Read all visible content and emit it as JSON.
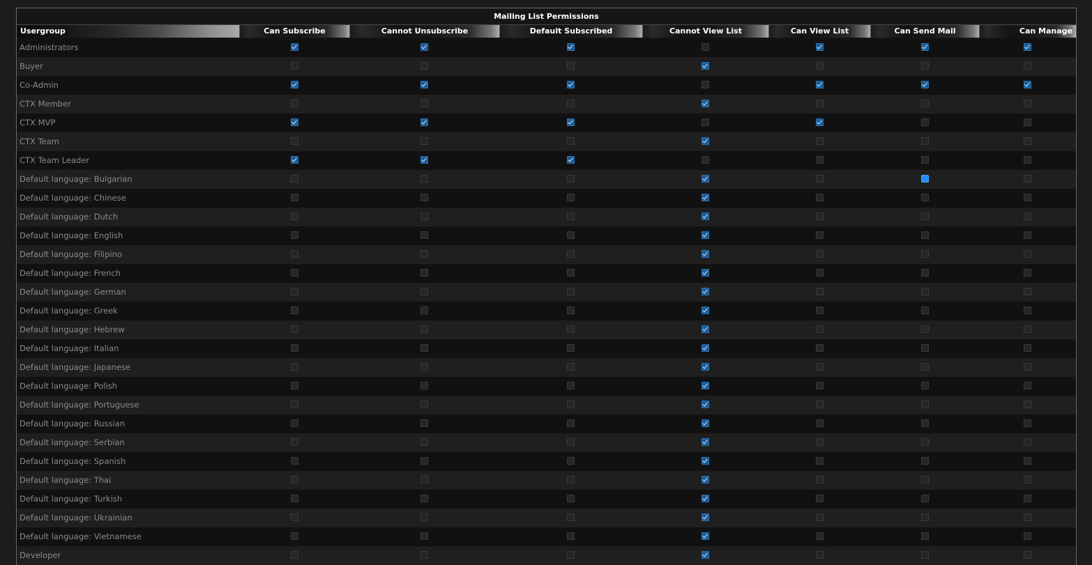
{
  "table": {
    "title": "Mailing List Permissions",
    "columns": [
      "Usergroup",
      "Can Subscribe",
      "Cannot Unsubscribe",
      "Default Subscribed",
      "Cannot View List",
      "Can View List",
      "Can Send Mail",
      "Can Manage"
    ],
    "rows": [
      {
        "label": "Administrators",
        "values": [
          true,
          true,
          true,
          false,
          true,
          true,
          true
        ]
      },
      {
        "label": "Buyer",
        "values": [
          false,
          false,
          false,
          true,
          false,
          false,
          false
        ]
      },
      {
        "label": "Co-Admin",
        "values": [
          true,
          true,
          true,
          false,
          true,
          true,
          true
        ]
      },
      {
        "label": "CTX Member",
        "values": [
          false,
          false,
          false,
          true,
          false,
          false,
          false
        ]
      },
      {
        "label": "CTX MVP",
        "values": [
          true,
          true,
          true,
          false,
          true,
          false,
          false
        ]
      },
      {
        "label": "CTX Team",
        "values": [
          false,
          false,
          false,
          true,
          false,
          false,
          false
        ]
      },
      {
        "label": "CTX Team Leader",
        "values": [
          true,
          true,
          true,
          false,
          false,
          false,
          false
        ]
      },
      {
        "label": "Default language: Bulgarian",
        "values": [
          false,
          false,
          false,
          true,
          false,
          "focus",
          false
        ]
      },
      {
        "label": "Default language: Chinese",
        "values": [
          false,
          false,
          false,
          true,
          false,
          false,
          false
        ]
      },
      {
        "label": "Default language: Dutch",
        "values": [
          false,
          false,
          false,
          true,
          false,
          false,
          false
        ]
      },
      {
        "label": "Default language: English",
        "values": [
          false,
          false,
          false,
          true,
          false,
          false,
          false
        ]
      },
      {
        "label": "Default language: Filipino",
        "values": [
          false,
          false,
          false,
          true,
          false,
          false,
          false
        ]
      },
      {
        "label": "Default language: French",
        "values": [
          false,
          false,
          false,
          true,
          false,
          false,
          false
        ]
      },
      {
        "label": "Default language: German",
        "values": [
          false,
          false,
          false,
          true,
          false,
          false,
          false
        ]
      },
      {
        "label": "Default language: Greek",
        "values": [
          false,
          false,
          false,
          true,
          false,
          false,
          false
        ]
      },
      {
        "label": "Default language: Hebrew",
        "values": [
          false,
          false,
          false,
          true,
          false,
          false,
          false
        ]
      },
      {
        "label": "Default language: Italian",
        "values": [
          false,
          false,
          false,
          true,
          false,
          false,
          false
        ]
      },
      {
        "label": "Default language: Japanese",
        "values": [
          false,
          false,
          false,
          true,
          false,
          false,
          false
        ]
      },
      {
        "label": "Default language: Polish",
        "values": [
          false,
          false,
          false,
          true,
          false,
          false,
          false
        ]
      },
      {
        "label": "Default language: Portuguese",
        "values": [
          false,
          false,
          false,
          true,
          false,
          false,
          false
        ]
      },
      {
        "label": "Default language: Russian",
        "values": [
          false,
          false,
          false,
          true,
          false,
          false,
          false
        ]
      },
      {
        "label": "Default language: Serbian",
        "values": [
          false,
          false,
          false,
          true,
          false,
          false,
          false
        ]
      },
      {
        "label": "Default language: Spanish",
        "values": [
          false,
          false,
          false,
          true,
          false,
          false,
          false
        ]
      },
      {
        "label": "Default language: Thai",
        "values": [
          false,
          false,
          false,
          true,
          false,
          false,
          false
        ]
      },
      {
        "label": "Default language: Turkish",
        "values": [
          false,
          false,
          false,
          true,
          false,
          false,
          false
        ]
      },
      {
        "label": "Default language: Ukrainian",
        "values": [
          false,
          false,
          false,
          true,
          false,
          false,
          false
        ]
      },
      {
        "label": "Default language: Vietnamese",
        "values": [
          false,
          false,
          false,
          true,
          false,
          false,
          false
        ]
      },
      {
        "label": "Developer",
        "values": [
          false,
          false,
          false,
          true,
          false,
          false,
          false
        ]
      }
    ]
  },
  "colors": {
    "checked": "#1d5d9a",
    "focused": "#1f8fff",
    "row_odd": "#111111",
    "row_even": "#1f1f1f"
  }
}
